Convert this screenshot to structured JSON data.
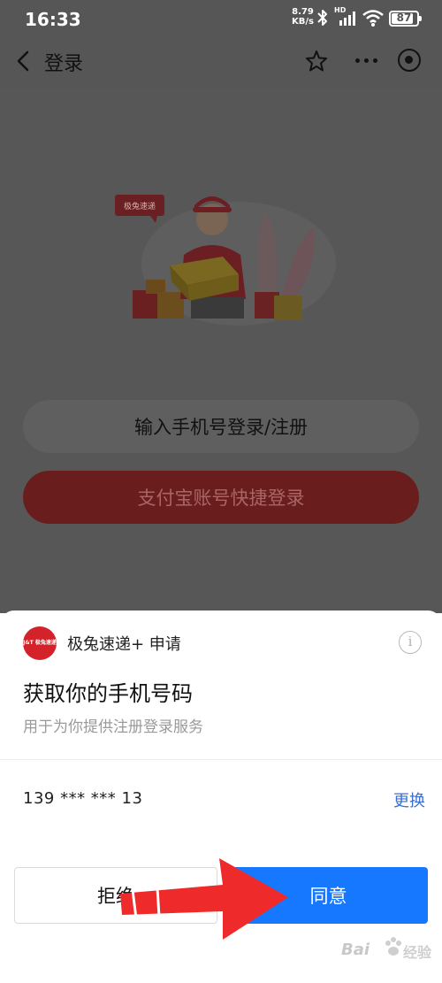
{
  "status_bar": {
    "time": "16:33",
    "net_speed_value": "8.79",
    "net_speed_unit": "KB/s",
    "network_label": "HD",
    "battery": "87"
  },
  "navbar": {
    "title": "登录"
  },
  "page": {
    "illustration_sign": "极兔速递",
    "phone_login_label": "输入手机号登录/注册",
    "alipay_login_label": "支付宝账号快捷登录"
  },
  "sheet": {
    "logo_text": "J&T 极兔速递",
    "app_name": "极兔速递+ 申请",
    "title": "获取你的手机号码",
    "subtitle": "用于为你提供注册登录服务",
    "phone_number": "139 *** *** 13",
    "change_label": "更换",
    "reject_label": "拒绝",
    "agree_label": "同意"
  },
  "watermark": {
    "brand": "Bai",
    "suffix": "经验"
  },
  "colors": {
    "primary_blue": "#1677ff",
    "brand_red": "#d3222a",
    "annotation_arrow": "#ef2a2a",
    "overlay_gray": "#575757"
  }
}
